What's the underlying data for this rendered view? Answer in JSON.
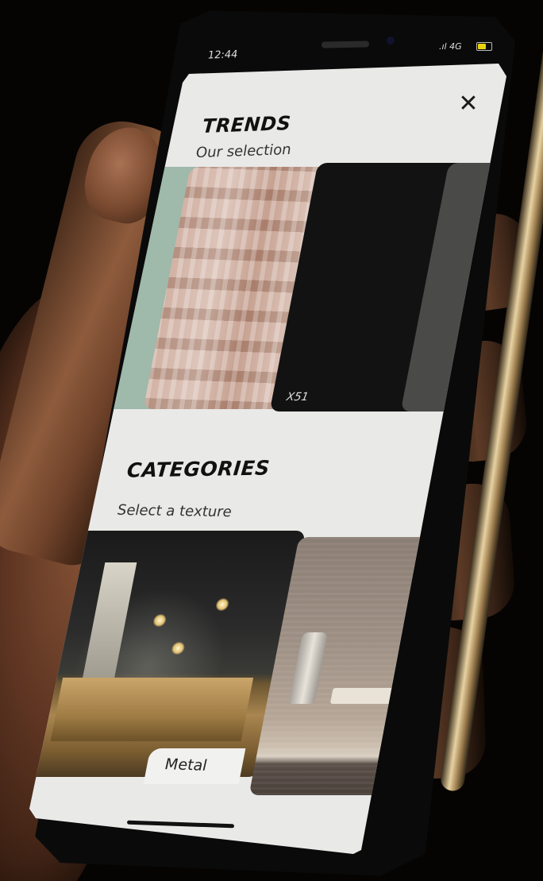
{
  "status_bar": {
    "time": "12:44",
    "signal_text": "4G",
    "battery_level": 0.6,
    "battery_color": "#e8d10b"
  },
  "close_icon_glyph": "✕",
  "trends": {
    "title": "TRENDS",
    "subtitle": "Our selection",
    "items": [
      {
        "label": ""
      },
      {
        "label": ""
      },
      {
        "label": "X51"
      },
      {
        "label": ""
      }
    ]
  },
  "categories": {
    "title": "CATEGORIES",
    "subtitle": "Select a texture",
    "items": [
      {
        "label": "Metal"
      },
      {
        "label": ""
      }
    ]
  },
  "colors": {
    "screen_background": "#e9e9e8",
    "title_text": "#111111",
    "phone_frame_gold": "#b89a6e"
  }
}
